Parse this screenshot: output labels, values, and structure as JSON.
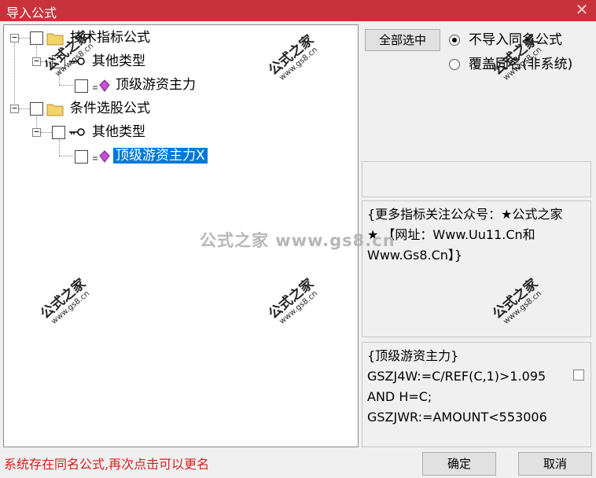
{
  "window": {
    "title": "导入公式",
    "close_glyph": "✕"
  },
  "tree": {
    "n1": "技术指标公式",
    "n1_1": "其他类型",
    "n1_1_1": "顶级游资主力",
    "n2": "条件选股公式",
    "n2_1": "其他类型",
    "n2_1_1": "顶级游资主力X",
    "expanded_glyph": "−"
  },
  "right": {
    "select_all": "全部选中",
    "radio_no_import": "不导入同名公式",
    "radio_overwrite": "覆盖同名(非系统)",
    "description": "{更多指标关注公众号：★公式之家★ 【网址：Www.Uu11.Cn和Www.Gs8.Cn】}",
    "code_text": "{顶级游资主力}\nGSZJ4W:=C/REF(C,1)>1.095\nAND H=C;\nGSZJWR:=AMOUNT<553006"
  },
  "footer": {
    "status_message": "系统存在同名公式,再次点击可以更名",
    "ok_label": "确定",
    "cancel_label": "取消"
  },
  "watermark": {
    "cn": "公式之家",
    "url": "www.gs8.cn",
    "center": "公式之家 www.gs8.cn"
  },
  "colors": {
    "titlebar": "#c8333b",
    "selection": "#0078d7",
    "status_text": "#d42020"
  }
}
